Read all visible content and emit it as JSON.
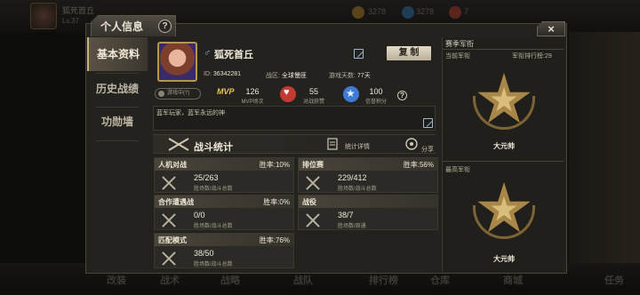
{
  "background": {
    "player_name": "狐死首丘",
    "player_level": "Lv.37",
    "resource_1": "3278",
    "resource_2": "3278",
    "resource_3": "7",
    "nav": [
      "改装",
      "战术",
      "战略",
      "战队",
      "排行榜",
      "仓库",
      "商城",
      "任务"
    ]
  },
  "window": {
    "title": "个人信息",
    "help": "?",
    "close": "×"
  },
  "side_tabs": [
    "基本资料",
    "历史战绩",
    "功勋墙"
  ],
  "profile": {
    "gender_symbol": "♂",
    "name": "狐死首丘",
    "copy_label": "复 制",
    "id_label": "ID:",
    "id_value": "36342281",
    "zone_label": "战区:",
    "zone_value": "全球慢匪",
    "days_label": "游戏天数:",
    "days_value": "77天",
    "status": "游戏中(?)",
    "mvp_mark": "MVP",
    "mvp_value": "126",
    "mvp_label": "MVP场次",
    "likes_value": "55",
    "likes_label": "对战获赞",
    "credit_value": "100",
    "credit_label": "信誉积分",
    "signature": "蓝军玩家，蓝军永远的神"
  },
  "battle": {
    "title": "战斗统计",
    "detail_link": "统计详情",
    "share_link": "分享",
    "cards": [
      {
        "name": "人机对战",
        "rate": "胜率:10%",
        "value": "25/263",
        "label": "胜场数/战斗总数"
      },
      {
        "name": "排位赛",
        "rate": "胜率:56%",
        "value": "229/412",
        "label": "胜场数/战斗总数"
      },
      {
        "name": "合作遭遇战",
        "rate": "胜率:0%",
        "value": "0/0",
        "label": "胜场数/战斗总数"
      },
      {
        "name": "战役",
        "rate": "",
        "value": "38/7",
        "label": "胜场数/周通"
      },
      {
        "name": "匹配模式",
        "rate": "胜率:76%",
        "value": "38/50",
        "label": "胜场数/战斗总数"
      }
    ]
  },
  "rank": {
    "header": "赛季军衔",
    "current_label": "当前军衔",
    "rank_label": "军衔排行榜:",
    "rank_value": "29",
    "current_name": "大元帅",
    "highest_label": "最高军衔",
    "highest_name": "大元帅"
  }
}
